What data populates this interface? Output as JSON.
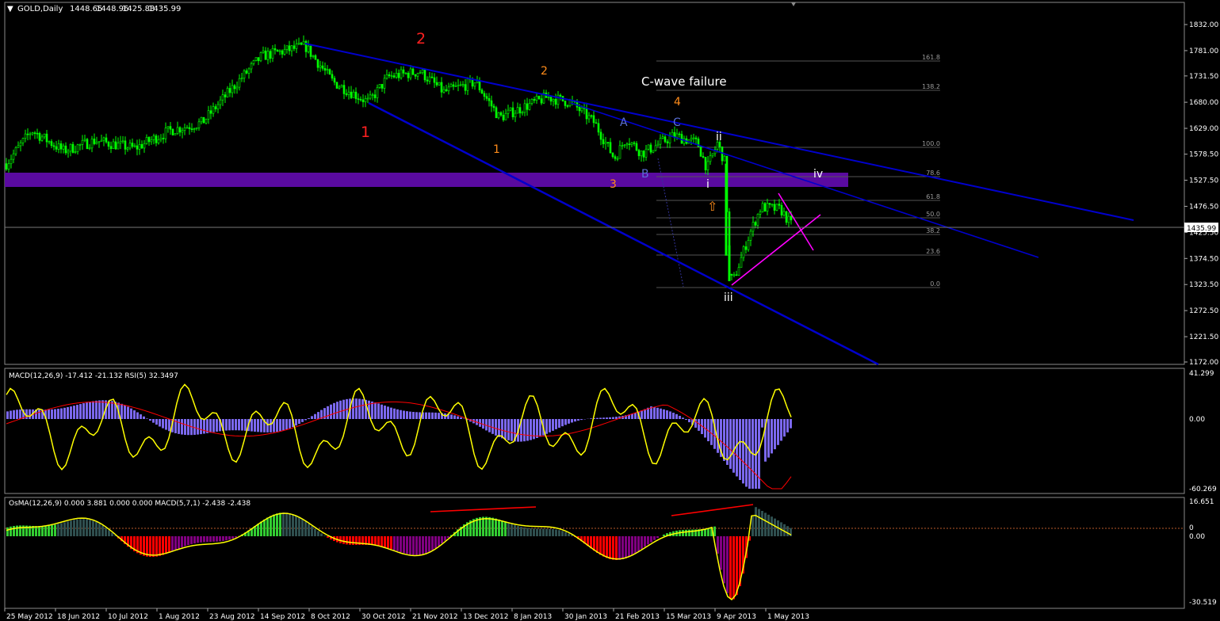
{
  "header": {
    "symbol": "GOLD,Daily",
    "open": "1448.65",
    "high": "1448.96",
    "low": "1425.83",
    "close": "1435.99"
  },
  "price_axis": {
    "ticks": [
      "1832.00",
      "1781.00",
      "1731.50",
      "1680.00",
      "1629.00",
      "1578.50",
      "1527.50",
      "1476.50",
      "1425.50",
      "1374.50",
      "1323.50",
      "1272.50",
      "1221.50",
      "1172.00"
    ],
    "current": "1435.99"
  },
  "time_axis": {
    "labels": [
      "25 May 2012",
      "18 Jun 2012",
      "10 Jul 2012",
      "1 Aug 2012",
      "23 Aug 2012",
      "14 Sep 2012",
      "8 Oct 2012",
      "30 Oct 2012",
      "21 Nov 2012",
      "13 Dec 2012",
      "8 Jan 2013",
      "30 Jan 2013",
      "21 Feb 2013",
      "15 Mar 2013",
      "9 Apr 2013",
      "1 May 2013"
    ]
  },
  "annotations": {
    "title": "C-wave failure",
    "wave_labels": [
      {
        "text": "2",
        "color": "#ff2020",
        "big": true
      },
      {
        "text": "1",
        "color": "#ff2020",
        "big": true
      },
      {
        "text": "2",
        "color": "#ff8c1a",
        "big": false
      },
      {
        "text": "1",
        "color": "#ff8c1a",
        "big": false
      },
      {
        "text": "3",
        "color": "#ff8c1a",
        "big": false
      },
      {
        "text": "4",
        "color": "#ff8c1a",
        "big": false
      },
      {
        "text": "A",
        "color": "#5a6fd8",
        "big": false
      },
      {
        "text": "B",
        "color": "#5a6fd8",
        "big": false
      },
      {
        "text": "C",
        "color": "#5a6fd8",
        "big": false
      },
      {
        "text": "ii",
        "color": "#ffffff",
        "big": false
      },
      {
        "text": "i",
        "color": "#ffffff",
        "big": false
      },
      {
        "text": "iii",
        "color": "#ffffff",
        "big": false
      },
      {
        "text": "iv",
        "color": "#ffffff",
        "big": false
      }
    ],
    "fib_levels": [
      "161.8",
      "138.2",
      "100.0",
      "78.6",
      "61.8",
      "50.0",
      "38.2",
      "23.6",
      "0.0"
    ],
    "arrow_glyph": "⇧"
  },
  "macd_panel": {
    "label": "MACD(12,26,9) -17.412 -21.132  RSI(5) 32.3497",
    "ticks": [
      "41.299",
      "0.00",
      "-60.269"
    ]
  },
  "osma_panel": {
    "label": "OsMA(12,26,9) 0.000 3.881 0.000 0.000  MACD(5,7,1) -2.438 -2.438",
    "ticks": [
      "16.651",
      "0",
      "0.00",
      "-30.519"
    ]
  },
  "colors": {
    "candle": "#00ff00",
    "trendline": "#0000cc",
    "zone": "#5a0aa0",
    "rsi": "#ffff00",
    "macd_hist": "#7b68ee",
    "signal": "#ff0000",
    "osma_pos_strong": "#32cd32",
    "osma_pos_weak": "#2f4f4f",
    "osma_neg_strong": "#ff0000",
    "osma_neg_weak": "#800080",
    "wedge": "#ff00ff"
  },
  "chart_data": {
    "type": "line",
    "title": "",
    "symbol": "GOLD",
    "timeframe": "Daily",
    "ylim": [
      1172,
      1832
    ],
    "x": [
      "25 May 2012",
      "18 Jun 2012",
      "10 Jul 2012",
      "1 Aug 2012",
      "23 Aug 2012",
      "14 Sep 2012",
      "8 Oct 2012",
      "30 Oct 2012",
      "21 Nov 2012",
      "13 Dec 2012",
      "8 Jan 2013",
      "30 Jan 2013",
      "21 Feb 2013",
      "15 Mar 2013",
      "9 Apr 2013",
      "1 May 2013"
    ],
    "series": [
      {
        "values": [
          1560,
          1625,
          1590,
          1615,
          1650,
          1770,
          1785,
          1710,
          1730,
          1700,
          1660,
          1670,
          1585,
          1610,
          1340,
          1440
        ]
      }
    ],
    "last": 1435.99,
    "grid": false
  }
}
